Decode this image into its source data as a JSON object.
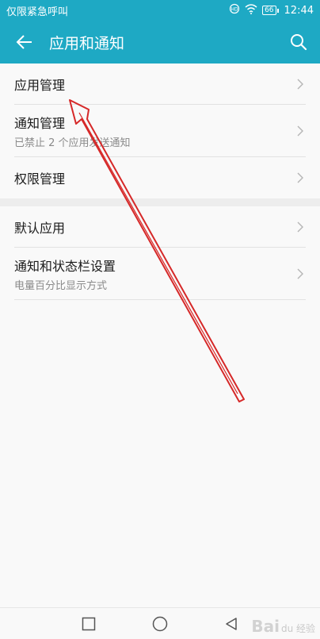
{
  "status_bar": {
    "left_text": "仅限紧急呼叫",
    "battery": "66",
    "time": "12:44"
  },
  "header": {
    "title": "应用和通知",
    "back_icon": "arrow-left-icon",
    "search_icon": "search-icon"
  },
  "groups": [
    {
      "items": [
        {
          "label": "应用管理",
          "sub": ""
        },
        {
          "label": "通知管理",
          "sub": "已禁止 2 个应用发送通知"
        },
        {
          "label": "权限管理",
          "sub": ""
        }
      ]
    },
    {
      "items": [
        {
          "label": "默认应用",
          "sub": ""
        },
        {
          "label": "通知和状态栏设置",
          "sub": "电量百分比显示方式"
        }
      ]
    }
  ],
  "nav": {
    "recents_icon": "square-icon",
    "home_icon": "circle-icon",
    "back_icon": "triangle-back-icon"
  },
  "watermark": {
    "brand": "Bai",
    "rest": "du 经验"
  },
  "colors": {
    "accent": "#1ea9c4",
    "annotation": "#d62828"
  }
}
